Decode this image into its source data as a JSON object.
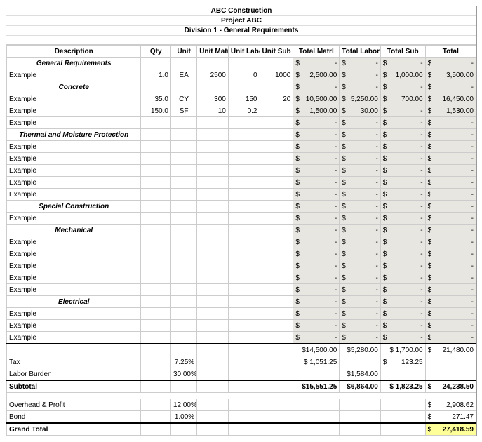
{
  "header": {
    "company": "ABC Construction",
    "project": "Project ABC",
    "division": "Division 1 - General Requirements"
  },
  "columns": {
    "description": "Description",
    "qty": "Qty",
    "unit": "Unit",
    "unit_matrl": "Unit Matrl",
    "unit_labor": "Unit Labor",
    "unit_sub": "Unit Sub",
    "total_matrl": "Total Matrl",
    "total_labor": "Total Labor",
    "total_sub": "Total Sub",
    "total": "Total"
  },
  "sections": [
    {
      "name": "General Requirements",
      "totals": {
        "tm": "-",
        "tl": "-",
        "ts": "-",
        "tot": "-"
      },
      "rows": [
        {
          "desc": "Example",
          "qty": "1.0",
          "unit": "EA",
          "um": "2500",
          "ul": "0",
          "us": "1000",
          "tm": "2,500.00",
          "tl": "-",
          "ts": "1,000.00",
          "tot": "3,500.00"
        }
      ]
    },
    {
      "name": "Concrete",
      "totals": {
        "tm": "-",
        "tl": "-",
        "ts": "-",
        "tot": "-"
      },
      "rows": [
        {
          "desc": "Example",
          "qty": "35.0",
          "unit": "CY",
          "um": "300",
          "ul": "150",
          "us": "20",
          "tm": "10,500.00",
          "tl": "5,250.00",
          "ts": "700.00",
          "tot": "16,450.00"
        },
        {
          "desc": "Example",
          "qty": "150.0",
          "unit": "SF",
          "um": "10",
          "ul": "0.2",
          "us": "",
          "tm": "1,500.00",
          "tl": "30.00",
          "ts": "-",
          "tot": "1,530.00"
        },
        {
          "desc": "Example",
          "qty": "",
          "unit": "",
          "um": "",
          "ul": "",
          "us": "",
          "tm": "-",
          "tl": "-",
          "ts": "-",
          "tot": "-"
        }
      ]
    },
    {
      "name": "Thermal and Moisture Protection",
      "totals": {
        "tm": "-",
        "tl": "-",
        "ts": "-",
        "tot": "-"
      },
      "rows": [
        {
          "desc": "Example",
          "qty": "",
          "unit": "",
          "um": "",
          "ul": "",
          "us": "",
          "tm": "-",
          "tl": "-",
          "ts": "-",
          "tot": "-"
        },
        {
          "desc": "Example",
          "qty": "",
          "unit": "",
          "um": "",
          "ul": "",
          "us": "",
          "tm": "-",
          "tl": "-",
          "ts": "-",
          "tot": "-"
        },
        {
          "desc": "Example",
          "qty": "",
          "unit": "",
          "um": "",
          "ul": "",
          "us": "",
          "tm": "-",
          "tl": "-",
          "ts": "-",
          "tot": "-"
        },
        {
          "desc": "Example",
          "qty": "",
          "unit": "",
          "um": "",
          "ul": "",
          "us": "",
          "tm": "-",
          "tl": "-",
          "ts": "-",
          "tot": "-"
        },
        {
          "desc": "Example",
          "qty": "",
          "unit": "",
          "um": "",
          "ul": "",
          "us": "",
          "tm": "-",
          "tl": "-",
          "ts": "-",
          "tot": "-"
        }
      ]
    },
    {
      "name": "Special Construction",
      "totals": {
        "tm": "-",
        "tl": "-",
        "ts": "-",
        "tot": "-"
      },
      "rows": [
        {
          "desc": "Example",
          "qty": "",
          "unit": "",
          "um": "",
          "ul": "",
          "us": "",
          "tm": "-",
          "tl": "-",
          "ts": "-",
          "tot": "-"
        }
      ]
    },
    {
      "name": "Mechanical",
      "totals": {
        "tm": "-",
        "tl": "-",
        "ts": "-",
        "tot": "-"
      },
      "rows": [
        {
          "desc": "Example",
          "qty": "",
          "unit": "",
          "um": "",
          "ul": "",
          "us": "",
          "tm": "-",
          "tl": "-",
          "ts": "-",
          "tot": "-"
        },
        {
          "desc": "Example",
          "qty": "",
          "unit": "",
          "um": "",
          "ul": "",
          "us": "",
          "tm": "-",
          "tl": "-",
          "ts": "-",
          "tot": "-"
        },
        {
          "desc": "Example",
          "qty": "",
          "unit": "",
          "um": "",
          "ul": "",
          "us": "",
          "tm": "-",
          "tl": "-",
          "ts": "-",
          "tot": "-"
        },
        {
          "desc": "Example",
          "qty": "",
          "unit": "",
          "um": "",
          "ul": "",
          "us": "",
          "tm": "-",
          "tl": "-",
          "ts": "-",
          "tot": "-"
        },
        {
          "desc": "Example",
          "qty": "",
          "unit": "",
          "um": "",
          "ul": "",
          "us": "",
          "tm": "-",
          "tl": "-",
          "ts": "-",
          "tot": "-"
        }
      ]
    },
    {
      "name": "Electrical",
      "totals": {
        "tm": "-",
        "tl": "-",
        "ts": "-",
        "tot": "-"
      },
      "rows": [
        {
          "desc": "Example",
          "qty": "",
          "unit": "",
          "um": "",
          "ul": "",
          "us": "",
          "tm": "-",
          "tl": "-",
          "ts": "-",
          "tot": "-"
        },
        {
          "desc": "Example",
          "qty": "",
          "unit": "",
          "um": "",
          "ul": "",
          "us": "",
          "tm": "-",
          "tl": "-",
          "ts": "-",
          "tot": "-"
        },
        {
          "desc": "Example",
          "qty": "",
          "unit": "",
          "um": "",
          "ul": "",
          "us": "",
          "tm": "-",
          "tl": "-",
          "ts": "-",
          "tot": "-"
        }
      ]
    }
  ],
  "totals_row": {
    "tm": "$14,500.00",
    "tl": "$5,280.00",
    "ts": "$ 1,700.00",
    "tot": "21,480.00"
  },
  "summary": {
    "tax": {
      "label": "Tax",
      "pct": "7.25%",
      "tm": "$ 1,051.25",
      "ts": "123.25"
    },
    "labor_burden": {
      "label": "Labor Burden",
      "pct": "30.00%",
      "tl": "$1,584.00"
    },
    "subtotal": {
      "label": "Subtotal",
      "tm": "$15,551.25",
      "tl": "$6,864.00",
      "ts": "$ 1,823.25",
      "tot": "24,238.50"
    },
    "overhead": {
      "label": "Overhead & Profit",
      "pct": "12.00%",
      "tot": "2,908.62"
    },
    "bond": {
      "label": "Bond",
      "pct": "1.00%",
      "tot": "271.47"
    },
    "grand": {
      "label": "Grand Total",
      "tot": "27,418.59"
    }
  }
}
